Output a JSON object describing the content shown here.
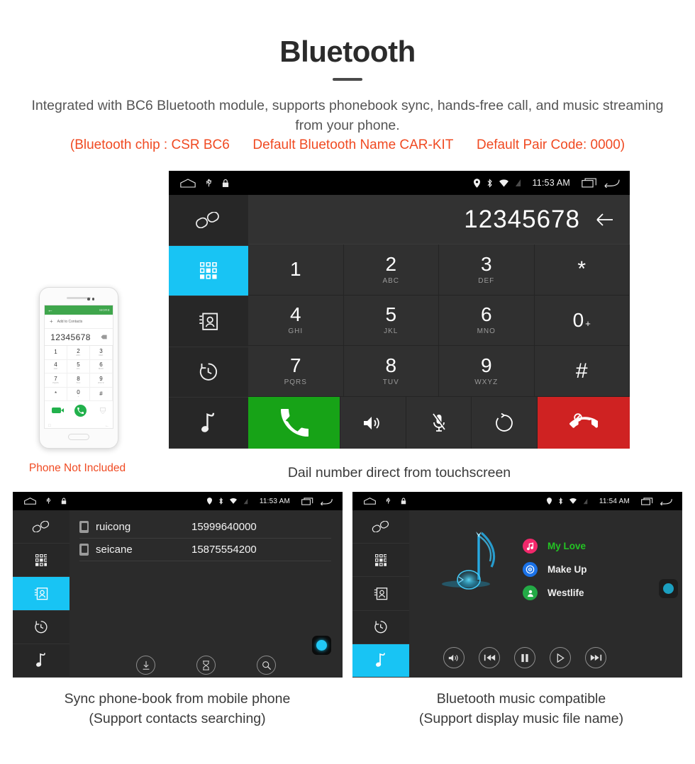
{
  "header": {
    "title": "Bluetooth",
    "subtitle": "Integrated with BC6 Bluetooth module, supports phonebook sync, hands-free call, and music streaming from your phone.",
    "note_chip": "(Bluetooth chip : CSR BC6",
    "note_name": "Default Bluetooth Name CAR-KIT",
    "note_pair": "Default Pair Code: 0000)",
    "accent_red": "#f04a22"
  },
  "colors": {
    "accent_cyan": "#18c4f4",
    "call_green": "#17a317",
    "end_red": "#cf2222",
    "screen_bg": "#2b2b2b",
    "key_bg": "#303030"
  },
  "sidebar": {
    "items": [
      {
        "name": "bluetooth-pair",
        "icon": "link-icon"
      },
      {
        "name": "keypad",
        "icon": "keypad-icon"
      },
      {
        "name": "contacts",
        "icon": "contacts-icon"
      },
      {
        "name": "call-history",
        "icon": "history-icon"
      },
      {
        "name": "music",
        "icon": "music-note-icon"
      }
    ]
  },
  "dialer": {
    "statusbar": {
      "time": "11:53 AM",
      "left_icons": [
        "home-icon",
        "usb-icon",
        "lock-icon"
      ],
      "right_icons": [
        "location-icon",
        "bluetooth-icon",
        "wifi-icon",
        "signal-icon",
        "recents-icon",
        "back-icon"
      ]
    },
    "active_sidebar_index": 1,
    "number": "12345678",
    "backspace_icon": "backspace-icon",
    "keys": [
      {
        "digit": "1",
        "letters": ""
      },
      {
        "digit": "2",
        "letters": "ABC"
      },
      {
        "digit": "3",
        "letters": "DEF"
      },
      {
        "digit": "*",
        "letters": ""
      },
      {
        "digit": "4",
        "letters": "GHI"
      },
      {
        "digit": "5",
        "letters": "JKL"
      },
      {
        "digit": "6",
        "letters": "MNO"
      },
      {
        "digit": "0",
        "letters": ""
      },
      {
        "digit": "7",
        "letters": "PQRS"
      },
      {
        "digit": "8",
        "letters": "TUV"
      },
      {
        "digit": "9",
        "letters": "WXYZ"
      },
      {
        "digit": "#",
        "letters": ""
      }
    ],
    "actions": [
      {
        "name": "call-button",
        "icon": "phone-icon"
      },
      {
        "name": "speaker-button",
        "icon": "speaker-icon"
      },
      {
        "name": "mute-button",
        "icon": "mic-muted-icon"
      },
      {
        "name": "transfer-call-button",
        "icon": "swap-icon"
      },
      {
        "name": "end-call-button",
        "icon": "phone-hangup-icon"
      }
    ],
    "caption": "Dail number direct from touchscreen"
  },
  "phone_mock": {
    "header_more": "MORE",
    "add_label": "Add to Contacts",
    "number": "12345678",
    "keys": [
      {
        "digit": "1",
        "letters": ""
      },
      {
        "digit": "2",
        "letters": "ABC"
      },
      {
        "digit": "3",
        "letters": "DEF"
      },
      {
        "digit": "4",
        "letters": "GHI"
      },
      {
        "digit": "5",
        "letters": "JKL"
      },
      {
        "digit": "6",
        "letters": "MNO"
      },
      {
        "digit": "7",
        "letters": "PQRS"
      },
      {
        "digit": "8",
        "letters": "TUV"
      },
      {
        "digit": "9",
        "letters": "WXYZ"
      },
      {
        "digit": "*",
        "letters": ""
      },
      {
        "digit": "0",
        "letters": "+"
      },
      {
        "digit": "#",
        "letters": ""
      }
    ],
    "caption": "Phone Not Included"
  },
  "contacts_screen": {
    "statusbar": {
      "time": "11:53 AM"
    },
    "active_sidebar_index": 2,
    "rows": [
      {
        "name": "ruicong",
        "number": "15999640000"
      },
      {
        "name": "seicane",
        "number": "15875554200"
      }
    ],
    "toolbar": [
      {
        "name": "download-contacts-button",
        "icon": "download-icon"
      },
      {
        "name": "delete-contacts-button",
        "icon": "delete-icon"
      },
      {
        "name": "search-contacts-button",
        "icon": "search-icon"
      }
    ],
    "home_button": "home-circle-icon",
    "caption_line1": "Sync phone-book from mobile phone",
    "caption_line2": "(Support contacts searching)"
  },
  "music_screen": {
    "statusbar": {
      "time": "11:54 AM"
    },
    "active_sidebar_index": 4,
    "items": [
      {
        "label": "My Love",
        "icon": "music-note-badge",
        "badge_color": "#f2286b",
        "highlight": true
      },
      {
        "label": "Make Up",
        "icon": "disc-badge",
        "badge_color": "#1a72e8",
        "highlight": false
      },
      {
        "label": "Westlife",
        "icon": "artist-badge",
        "badge_color": "#23aa46",
        "highlight": false
      }
    ],
    "controls": [
      {
        "name": "volume-button",
        "icon": "speaker-icon"
      },
      {
        "name": "previous-button",
        "icon": "prev-track-icon"
      },
      {
        "name": "pause-button",
        "icon": "pause-icon"
      },
      {
        "name": "play-button",
        "icon": "play-icon"
      },
      {
        "name": "next-button",
        "icon": "next-track-icon"
      }
    ],
    "home_button": "home-circle-icon",
    "caption_line1": "Bluetooth music compatible",
    "caption_line2": "(Support display music file name)"
  }
}
